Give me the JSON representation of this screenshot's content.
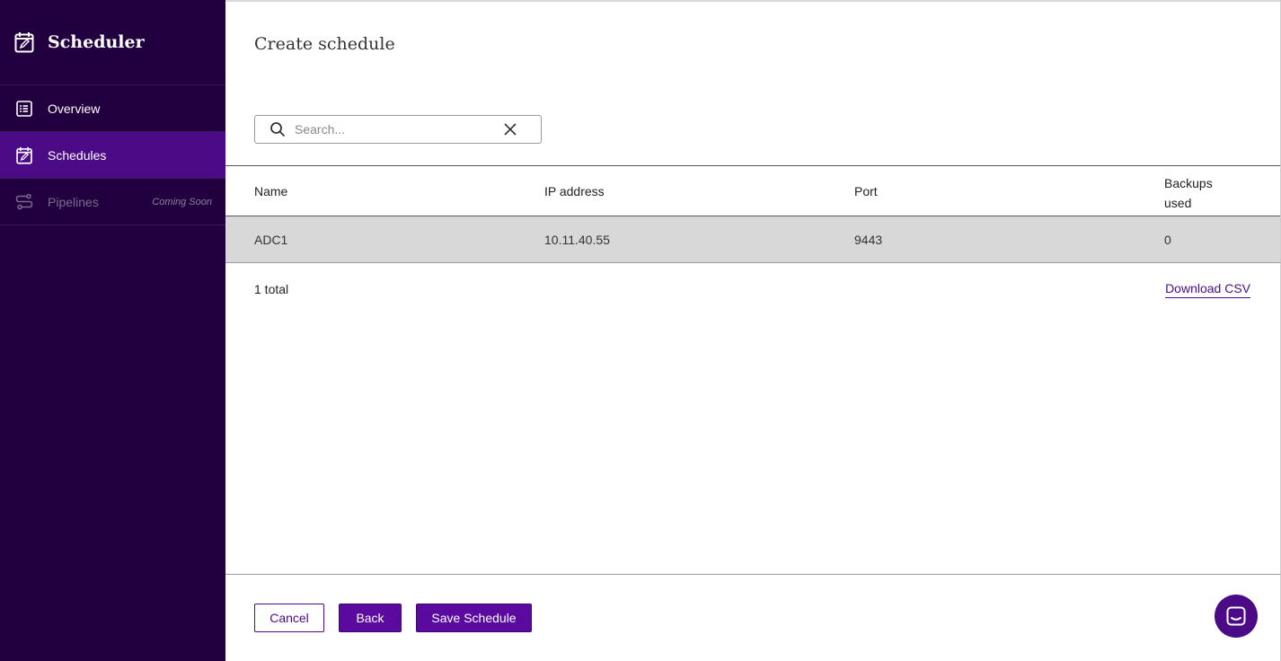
{
  "sidebar": {
    "app_title": "Scheduler",
    "items": [
      {
        "label": "Overview",
        "icon": "list-icon",
        "active": false
      },
      {
        "label": "Schedules",
        "icon": "calendar-edit-icon",
        "active": true
      },
      {
        "label": "Pipelines",
        "icon": "pipeline-icon",
        "active": false,
        "badge": "Coming Soon"
      }
    ]
  },
  "main": {
    "title": "Create schedule",
    "search": {
      "placeholder": "Search...",
      "value": ""
    },
    "table": {
      "columns": [
        "Name",
        "IP address",
        "Port",
        "Backups used"
      ],
      "rows": [
        {
          "name": "ADC1",
          "ip": "10.11.40.55",
          "port": "9443",
          "backups_used": "0"
        }
      ]
    },
    "total_text": "1 total",
    "download_label": "Download CSV"
  },
  "footer": {
    "cancel_label": "Cancel",
    "back_label": "Back",
    "save_label": "Save Schedule"
  },
  "colors": {
    "sidebar_bg": "#22003f",
    "active_nav": "#4b0a86",
    "primary": "#5a0a9e",
    "row_highlight": "#d8d8d8"
  },
  "chat_icon": "chat-icon"
}
